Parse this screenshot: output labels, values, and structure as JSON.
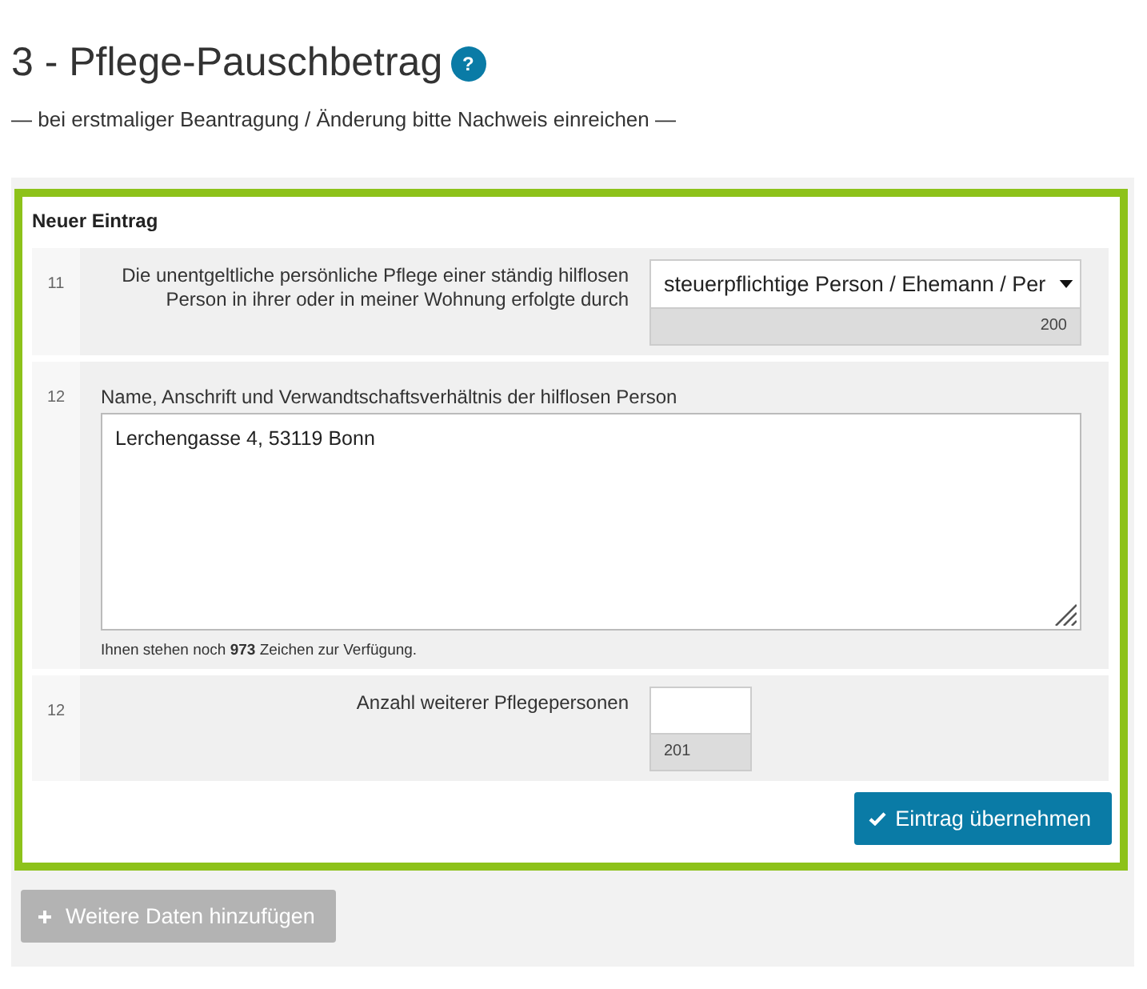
{
  "heading": {
    "title": "3 - Pflege-Pauschbetrag",
    "help": "?"
  },
  "subtitle": "— bei erstmaliger Beantragung / Änderung bitte Nachweis einreichen —",
  "entry": {
    "title": "Neuer Eintrag",
    "rows": [
      {
        "kind": "select",
        "number": "11",
        "label": "Die unentgeltliche persönliche Pflege einer ständig hilflosen Person in ihrer oder in meiner Wohnung erfolgte durch",
        "value": "steuerpflichtige Person / Ehemann / Per",
        "field_code": "200"
      },
      {
        "kind": "textarea",
        "number": "12",
        "label": "Name, Anschrift und Verwandtschaftsverhältnis der hilflosen Person",
        "value": "Lerchengasse 4, 53119 Bonn",
        "hint": "Ihnen stehen noch **973** Zeichen zur Verfügung."
      },
      {
        "kind": "input",
        "number": "12",
        "label": "Anzahl weiterer Pflegepersonen",
        "field_code": "201"
      }
    ],
    "submit": {
      "label": "Eintrag übernehmen"
    }
  },
  "add_button": {
    "label": "Weitere Daten hinzufügen",
    "disabled": true
  }
}
